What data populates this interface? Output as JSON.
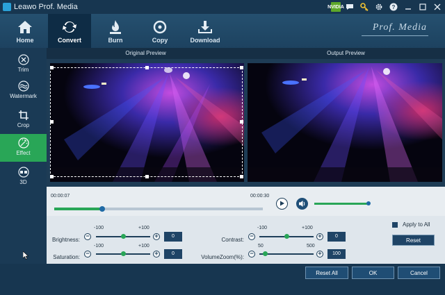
{
  "window": {
    "title": "Leawo Prof. Media"
  },
  "titlebar_icons": [
    "nvidia-icon",
    "chat-icon",
    "key-icon",
    "gear-icon",
    "help-icon",
    "minimize-icon",
    "maximize-icon",
    "close-icon"
  ],
  "titlebar_icon_labels": {
    "nvidia": "NVIDIA"
  },
  "toolbar": {
    "tabs": [
      {
        "label": "Home",
        "icon": "home-icon"
      },
      {
        "label": "Convert",
        "icon": "convert-icon"
      },
      {
        "label": "Burn",
        "icon": "burn-icon"
      },
      {
        "label": "Copy",
        "icon": "copy-icon"
      },
      {
        "label": "Download",
        "icon": "download-icon"
      }
    ],
    "active_tab": "Convert",
    "brand": "Prof. Media"
  },
  "sidebar": {
    "items": [
      {
        "label": "Trim",
        "icon": "scissors-icon"
      },
      {
        "label": "Watermark",
        "icon": "watermark-icon"
      },
      {
        "label": "Crop",
        "icon": "crop-icon"
      },
      {
        "label": "Effect",
        "icon": "effect-icon"
      },
      {
        "label": "3D",
        "icon": "3d-glasses-icon"
      }
    ],
    "active_item": "Effect"
  },
  "preview": {
    "original_title": "Original Preview",
    "output_title": "Output Preview"
  },
  "player": {
    "current_time": "00:00:07",
    "total_time": "00:00:30",
    "progress": 0.23,
    "volume": 1.0
  },
  "effects": {
    "brightness": {
      "label": "Brightness:",
      "min": "-100",
      "max": "+100",
      "value": "0",
      "fraction": 0.5
    },
    "saturation": {
      "label": "Saturation:",
      "min": "-100",
      "max": "+100",
      "value": "0",
      "fraction": 0.5
    },
    "contrast": {
      "label": "Contrast:",
      "min": "-100",
      "max": "+100",
      "value": "0",
      "fraction": 0.5
    },
    "volume_zoom": {
      "label": "VolumeZoom(%):",
      "min": "50",
      "max": "500",
      "value": "100",
      "fraction": 0.11
    }
  },
  "options": {
    "apply_to_all_label": "Apply to All",
    "apply_to_all_checked": false,
    "reset_label": "Reset"
  },
  "footer": {
    "reset_all_label": "Reset All",
    "ok_label": "OK",
    "cancel_label": "Cancel"
  },
  "colors": {
    "accent_green": "#29a657",
    "navy": "#1f4466",
    "titlebar": "#173650"
  }
}
